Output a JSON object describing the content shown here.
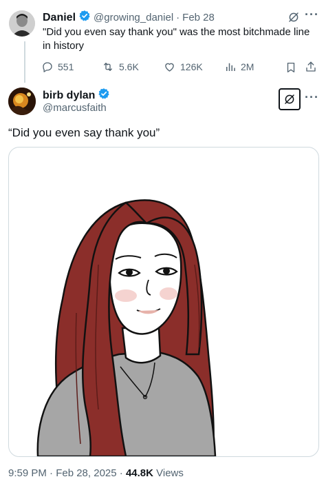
{
  "quoted_tweet": {
    "author_name": "Daniel",
    "handle": "@growing_daniel",
    "separator": "·",
    "date": "Feb 28",
    "text": "\"Did you even say thank you\" was the most bitchmade line in history",
    "replies": "551",
    "retweets": "5.6K",
    "likes": "126K",
    "views": "2M"
  },
  "main_tweet": {
    "author_name": "birb dylan",
    "handle": "@marcusfaith",
    "text": "“Did you even say thank you”",
    "timestamp": "9:59 PM · Feb 28, 2025 · ",
    "views_count": "44.8K",
    "views_label": " Views"
  },
  "colors": {
    "verified_blue": "#1d9bf0",
    "muted_text": "#536471",
    "border": "#cfd9de",
    "hair_red": "#8b2e2a",
    "shirt_gray": "#a6a6a6"
  },
  "icons": [
    "verified-badge-icon",
    "grok-icon",
    "more-options-icon",
    "reply-icon",
    "retweet-icon",
    "like-icon",
    "views-icon",
    "bookmark-icon",
    "share-icon"
  ]
}
